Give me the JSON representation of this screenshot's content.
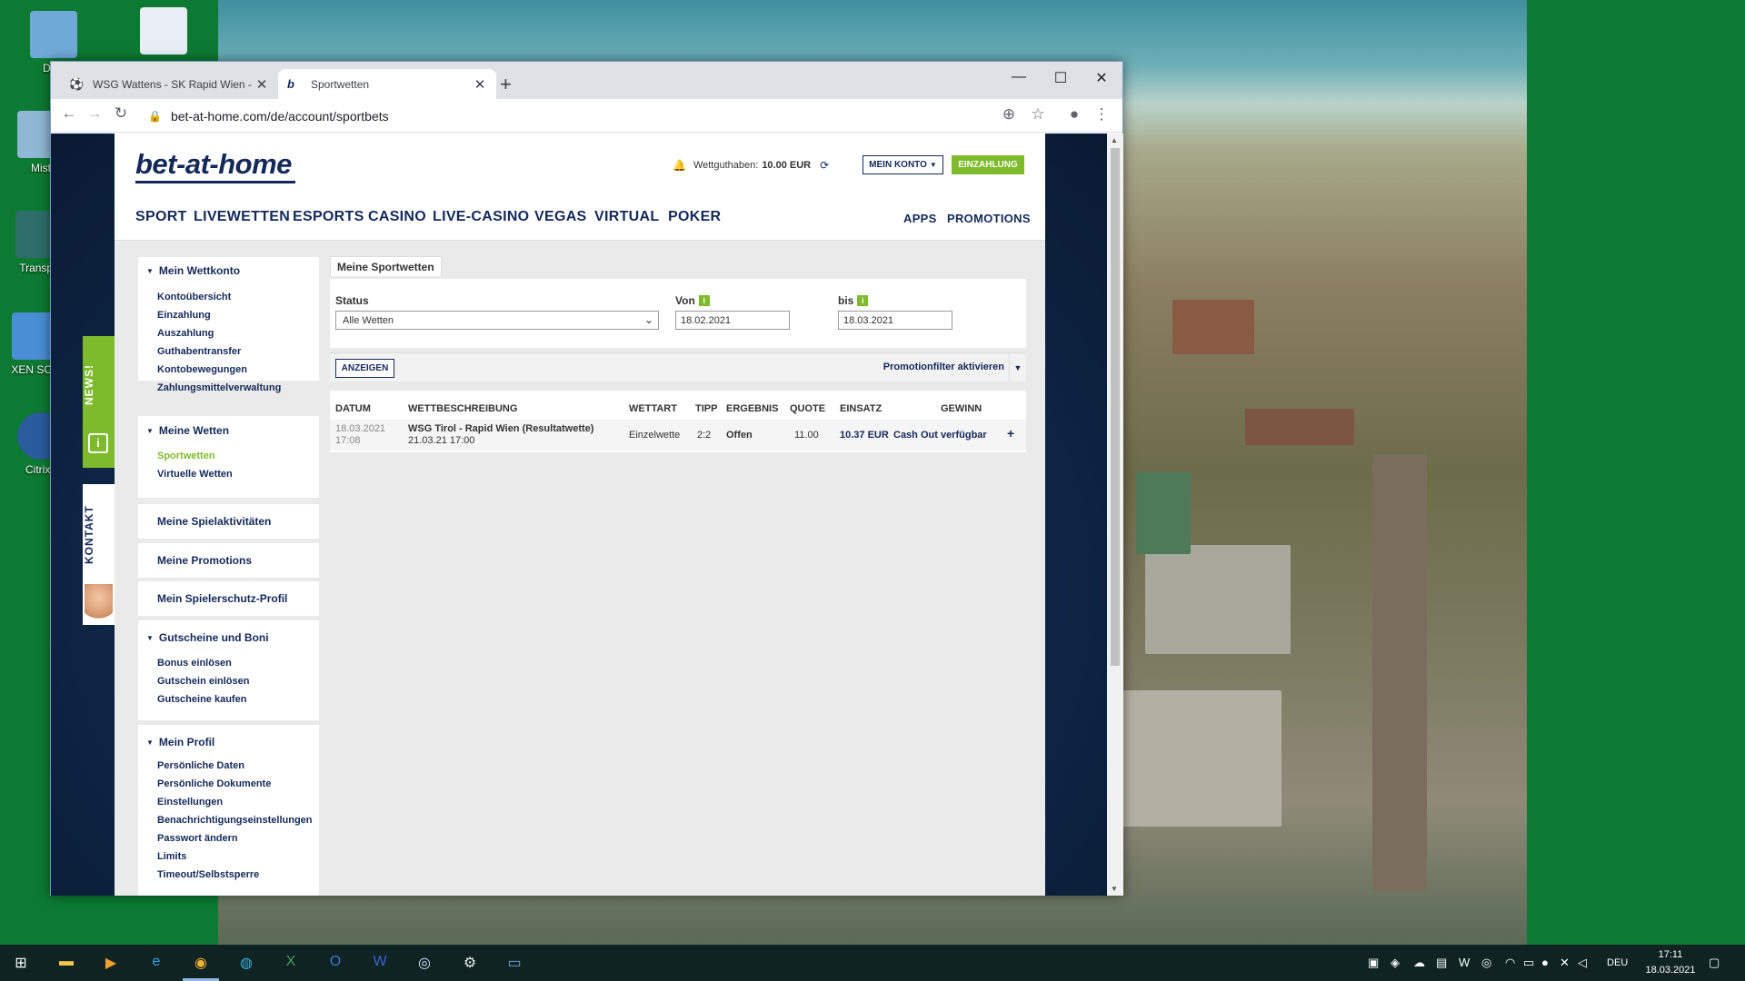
{
  "desktop": {
    "icons": [
      {
        "label": "Dies"
      },
      {
        "label": "Mist"
      },
      {
        "label": "Transpo"
      },
      {
        "label": "XEN SCH"
      },
      {
        "label": "Citrix I"
      }
    ]
  },
  "browser": {
    "tabs": [
      {
        "label": "WSG Wattens - SK Rapid Wien -"
      },
      {
        "label": "Sportwetten"
      }
    ],
    "url": "bet-at-home.com/de/account/sportbets"
  },
  "side_tabs": {
    "news": "NEWS!",
    "kontakt": "KONTAKT"
  },
  "site": {
    "logo": "bet-at-home",
    "balance_label": "Wettguthaben:",
    "balance_value": "10.00 EUR",
    "account_button": "MEIN KONTO",
    "deposit_button": "EINZAHLUNG",
    "nav": [
      "SPORT",
      "LIVEWETTEN",
      "ESPORTS",
      "CASINO",
      "LIVE-CASINO",
      "VEGAS",
      "VIRTUAL",
      "POKER"
    ],
    "nav_right": [
      "APPS",
      "PROMOTIONS"
    ]
  },
  "menu": {
    "wettkonto": {
      "title": "Mein Wettkonto",
      "items": [
        "Kontoübersicht",
        "Einzahlung",
        "Auszahlung",
        "Guthabentransfer",
        "Kontobewegungen",
        "Zahlungsmittelverwaltung"
      ]
    },
    "wetten": {
      "title": "Meine Wetten",
      "items": [
        "Sportwetten",
        "Virtuelle Wetten"
      ]
    },
    "spielaktivitaeten": "Meine Spielaktivitäten",
    "promotions": "Meine Promotions",
    "spielerschutz": "Mein Spielerschutz-Profil",
    "gutscheine": {
      "title": "Gutscheine und Boni",
      "items": [
        "Bonus einlösen",
        "Gutschein einlösen",
        "Gutscheine kaufen"
      ]
    },
    "profil": {
      "title": "Mein Profil",
      "items": [
        "Persönliche Daten",
        "Persönliche Dokumente",
        "Einstellungen",
        "Benachrichtigungseinstellungen",
        "Passwort ändern",
        "Limits",
        "Timeout/Selbstsperre"
      ]
    }
  },
  "content": {
    "tab_title": "Meine Sportwetten",
    "status_label": "Status",
    "status_value": "Alle Wetten",
    "von_label": "Von",
    "von_value": "18.02.2021",
    "bis_label": "bis",
    "bis_value": "18.03.2021",
    "show_button": "ANZEIGEN",
    "promo_filter": "Promotionfilter aktivieren",
    "table": {
      "headers": [
        "DATUM",
        "WETTBESCHREIBUNG",
        "WETTART",
        "TIPP",
        "ERGEBNIS",
        "QUOTE",
        "EINSATZ",
        "GEWINN"
      ],
      "row": {
        "date": "18.03.2021",
        "time": "17:08",
        "description": "WSG Tirol - Rapid Wien (Resultatwette)",
        "event_time": "21.03.21 17:00",
        "type": "Einzelwette",
        "tip": "2:2",
        "result": "Offen",
        "odds": "11.00",
        "stake": "10.37 EUR",
        "win": "Cash Out verfügbar",
        "expand": "+"
      }
    }
  },
  "taskbar": {
    "language": "DEU",
    "time": "17:11",
    "date": "18.03.2021"
  },
  "colors": {
    "brand_navy": "#14295a",
    "brand_green": "#7dbb2c"
  }
}
